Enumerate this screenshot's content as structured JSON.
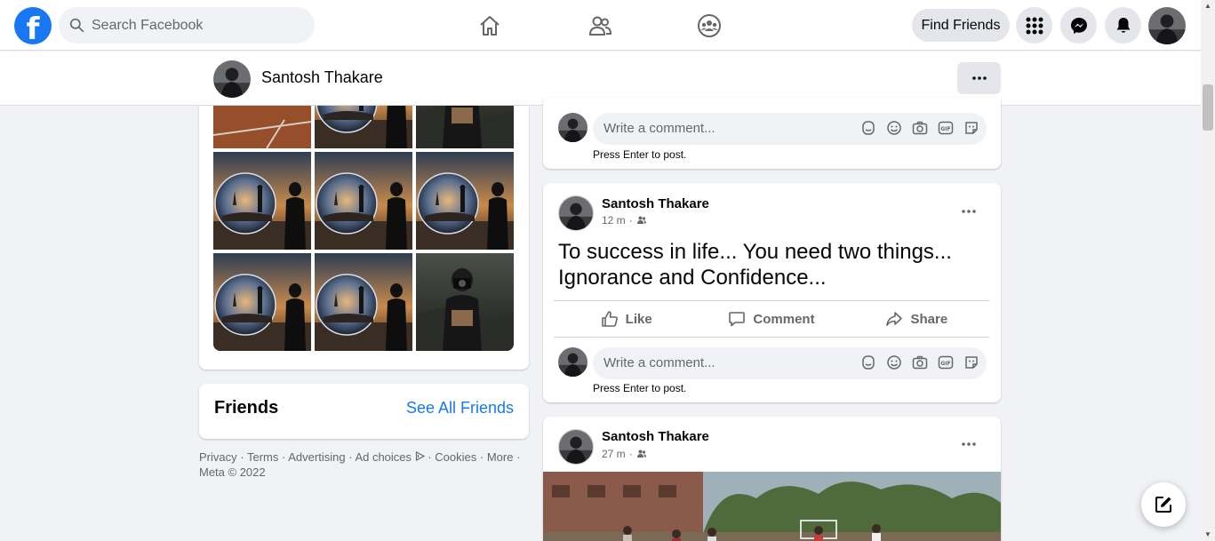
{
  "nav": {
    "logo_letter": "f",
    "search_placeholder": "Search Facebook",
    "find_friends_label": "Find Friends",
    "icons": [
      "home-icon",
      "friends-icon",
      "groups-icon",
      "menu-grid-icon",
      "messenger-icon",
      "notifications-icon"
    ]
  },
  "profile": {
    "name": "Santosh Thakare"
  },
  "friends": {
    "title": "Friends",
    "see_all_label": "See All Friends"
  },
  "footer": {
    "links": [
      "Privacy",
      "Terms",
      "Advertising",
      "Ad choices",
      "Cookies",
      "More"
    ],
    "separator": "·",
    "copyright": "Meta © 2022"
  },
  "comment": {
    "placeholder": "Write a comment...",
    "hint": "Press Enter to post."
  },
  "posts": [
    {
      "author": "Santosh Thakare",
      "time": "12 m",
      "text": "To success in life... You need two things... Ignorance and Confidence...",
      "actions": [
        "Like",
        "Comment",
        "Share"
      ]
    },
    {
      "author": "Santosh Thakare",
      "time": "27 m"
    }
  ],
  "colors": {
    "brand": "#1877f2",
    "background": "#f0f2f5",
    "secondary_text": "#65676b"
  }
}
